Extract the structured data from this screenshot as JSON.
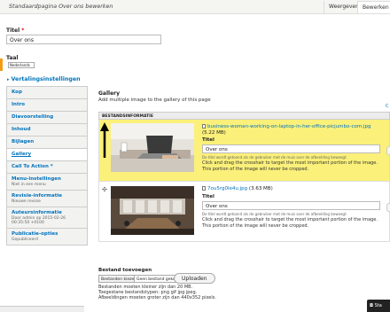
{
  "header": {
    "title": "Standaardpagina Over ons bewerken",
    "tabs": [
      {
        "label": "Weergeven"
      },
      {
        "label": "Bewerken"
      }
    ]
  },
  "form": {
    "titel_label": "Titel",
    "required_mark": "*",
    "titel_value": "Over ons",
    "taal_label": "Taal",
    "taal_value": "Nederlands",
    "vertaling_link": "Vertalingsinstellingen"
  },
  "sidebar": {
    "items": [
      {
        "label": "Kop"
      },
      {
        "label": "Intro"
      },
      {
        "label": "Diavoorstelling"
      },
      {
        "label": "Inhoud"
      },
      {
        "label": "Bijlagen"
      },
      {
        "label": "Gallery"
      },
      {
        "label": "Call To Action *"
      },
      {
        "label": "Menu-instellingen",
        "sub": "Niet in een menu"
      },
      {
        "label": "Revisie-informatie",
        "sub": "Nieuwe revisie"
      },
      {
        "label": "Auteursinformatie",
        "sub": "Door admin op 2015-02-26 00:35:50 +0100"
      },
      {
        "label": "Publicatie-opties",
        "sub": "Gepubliceerd"
      }
    ]
  },
  "gallery": {
    "title": "Gallery",
    "description": "Add multiple image to the gallery of this page",
    "column_header": "BESTANDSINFORMATIE",
    "side_link": "C",
    "items": [
      {
        "filename": "business-woman-working-on-laptop-in-her-office-picjumbo-com.jpg",
        "size": "(5.22 MB)",
        "titel_label": "Titel",
        "titel_value": "Over ons",
        "hint": "De titel wordt getoond als de gebruiker met de muis over de afbeelding beweegt.",
        "help1": "Click and drag the crosshair to target the most important portion of the image.",
        "help2": "This portion of the image will never be cropped."
      },
      {
        "filename": "7ou5rg0le4u.jpg",
        "size": "(3.63 MB)",
        "titel_label": "Titel",
        "titel_value": "Over ons",
        "hint": "De titel wordt getoond als de gebruiker met de muis over de afbeelding beweegt.",
        "help1": "Click and drag the crosshair to target the most important portion of the image.",
        "help2": "This portion of the image will never be cropped."
      }
    ]
  },
  "upload": {
    "title": "Bestand toevoegen",
    "choose_label": "Bestanden kiezen",
    "no_file_label": "Geen bestand gekozen",
    "upload_label": "Uploaden",
    "info1": "Bestanden moeten kleiner zijn dan 20 MB.",
    "info2": "Toegestane bestandstypen: png gif jpg jpeg.",
    "info3": "Afbeeldingen moeten groter zijn dan 440x352 pixels."
  },
  "float_button": {
    "label": "Sta"
  },
  "colors": {
    "highlight": "#fbf07a",
    "link": "#0074bd",
    "accent": "#f39c12"
  }
}
